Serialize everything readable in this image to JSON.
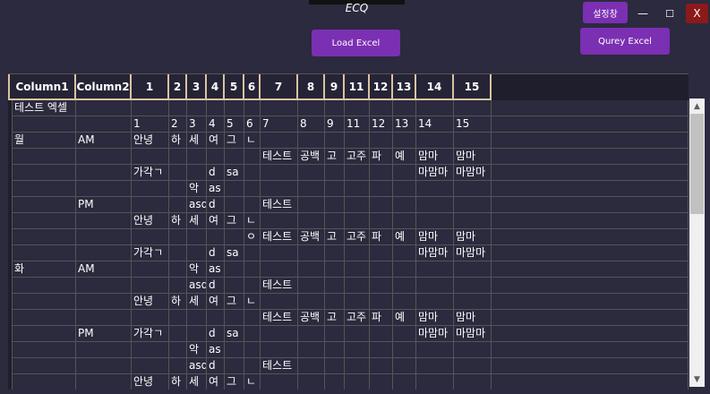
{
  "window": {
    "title": "ECQ",
    "settings_label": "설정창",
    "minimize": "—",
    "maximize": "☐",
    "close": "X"
  },
  "toolbar": {
    "load_label": "Load Excel",
    "query_label": "Qurey Excel"
  },
  "grid": {
    "headers": [
      "Column1",
      "Column2",
      "1",
      "2",
      "3",
      "4",
      "5",
      "6",
      "7",
      "8",
      "9",
      "11",
      "12",
      "13",
      "14",
      "15"
    ],
    "rows": [
      [
        "테스트 엑셀",
        "",
        "",
        "",
        "",
        "",
        "",
        "",
        "",
        "",
        "",
        "",
        "",
        "",
        "",
        ""
      ],
      [
        "",
        "",
        "1",
        "2",
        "3",
        "4",
        "5",
        "6",
        "7",
        "8",
        "9",
        "11",
        "12",
        "13",
        "14",
        "15"
      ],
      [
        "월",
        "AM",
        "안녕",
        "하",
        "세",
        "여",
        "그",
        "ㄴ",
        "",
        "",
        "",
        "",
        "",
        "",
        "",
        ""
      ],
      [
        "",
        "",
        "",
        "",
        "",
        "",
        "",
        "",
        "테스트",
        "공백",
        "고",
        "고주",
        "파",
        "예",
        "맘마",
        "맘마"
      ],
      [
        "",
        "",
        "가각ㄱ",
        "",
        "",
        "d",
        "sa",
        "",
        "",
        "",
        "",
        "",
        "",
        "",
        "마맘마",
        "마맘마"
      ],
      [
        "",
        "",
        "",
        "",
        "악",
        "as",
        "",
        "",
        "",
        "",
        "",
        "",
        "",
        "",
        "",
        ""
      ],
      [
        "",
        "PM",
        "",
        "",
        "asd",
        "d",
        "",
        "",
        "테스트",
        "",
        "",
        "",
        "",
        "",
        "",
        ""
      ],
      [
        "",
        "",
        "안녕",
        "하",
        "세",
        "여",
        "그",
        "ㄴ",
        "",
        "",
        "",
        "",
        "",
        "",
        "",
        ""
      ],
      [
        "",
        "",
        "",
        "",
        "",
        "",
        "",
        "ㅇ",
        "테스트",
        "공백",
        "고",
        "고주",
        "파",
        "예",
        "맘마",
        "맘마"
      ],
      [
        "",
        "",
        "가각ㄱ",
        "",
        "",
        "d",
        "sa",
        "",
        "",
        "",
        "",
        "",
        "",
        "",
        "마맘마",
        "마맘마"
      ],
      [
        "화",
        "AM",
        "",
        "",
        "악",
        "as",
        "",
        "",
        "",
        "",
        "",
        "",
        "",
        "",
        "",
        ""
      ],
      [
        "",
        "",
        "",
        "",
        "asd",
        "d",
        "",
        "",
        "테스트",
        "",
        "",
        "",
        "",
        "",
        "",
        ""
      ],
      [
        "",
        "",
        "안녕",
        "하",
        "세",
        "여",
        "그",
        "ㄴ",
        "",
        "",
        "",
        "",
        "",
        "",
        "",
        ""
      ],
      [
        "",
        "",
        "",
        "",
        "",
        "",
        "",
        "",
        "테스트",
        "공백",
        "고",
        "고주",
        "파",
        "예",
        "맘마",
        "맘마"
      ],
      [
        "",
        "PM",
        "가각ㄱ",
        "",
        "",
        "d",
        "sa",
        "",
        "",
        "",
        "",
        "",
        "",
        "",
        "마맘마",
        "마맘마"
      ],
      [
        "",
        "",
        "",
        "",
        "악",
        "as",
        "",
        "",
        "",
        "",
        "",
        "",
        "",
        "",
        "",
        ""
      ],
      [
        "",
        "",
        "",
        "",
        "asd",
        "d",
        "",
        "",
        "테스트",
        "",
        "",
        "",
        "",
        "",
        "",
        ""
      ],
      [
        "",
        "",
        "안녕",
        "하",
        "세",
        "여",
        "그",
        "ㄴ",
        "",
        "",
        "",
        "",
        "",
        "",
        "",
        ""
      ]
    ]
  }
}
